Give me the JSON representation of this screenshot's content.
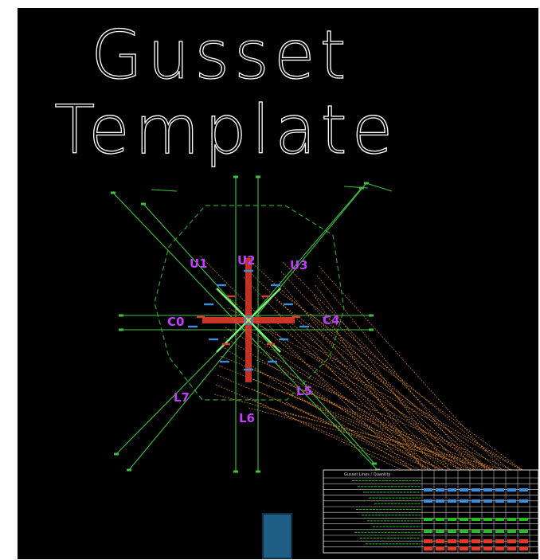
{
  "title": {
    "line1": "Gusset",
    "line2": "Template"
  },
  "nodes": [
    {
      "id": "U1",
      "label": "U1"
    },
    {
      "id": "U2",
      "label": "U2"
    },
    {
      "id": "U3",
      "label": "U3"
    },
    {
      "id": "C0",
      "label": "C0"
    },
    {
      "id": "C4",
      "label": "C4"
    },
    {
      "id": "L7",
      "label": "L7"
    },
    {
      "id": "L5",
      "label": "L5"
    },
    {
      "id": "L6",
      "label": "L6"
    }
  ],
  "colors": {
    "background": "#000000",
    "title_stroke": "#ffffff",
    "node_label": "#c040ff",
    "member_lines": "#3fbf3f",
    "outline_dashed": "#2f9f2f",
    "leader_lines": "#e08a2a",
    "center_red": "#e23a2a",
    "accent_blue": "#3a8fe0",
    "table_lines": "#d8d8d8",
    "table_green": "#22c022",
    "table_red": "#e23a2a",
    "table_blue": "#3a8fe0",
    "marker": "#1f5f86"
  },
  "table": {
    "header": "Gusset Lines / Quantity"
  }
}
